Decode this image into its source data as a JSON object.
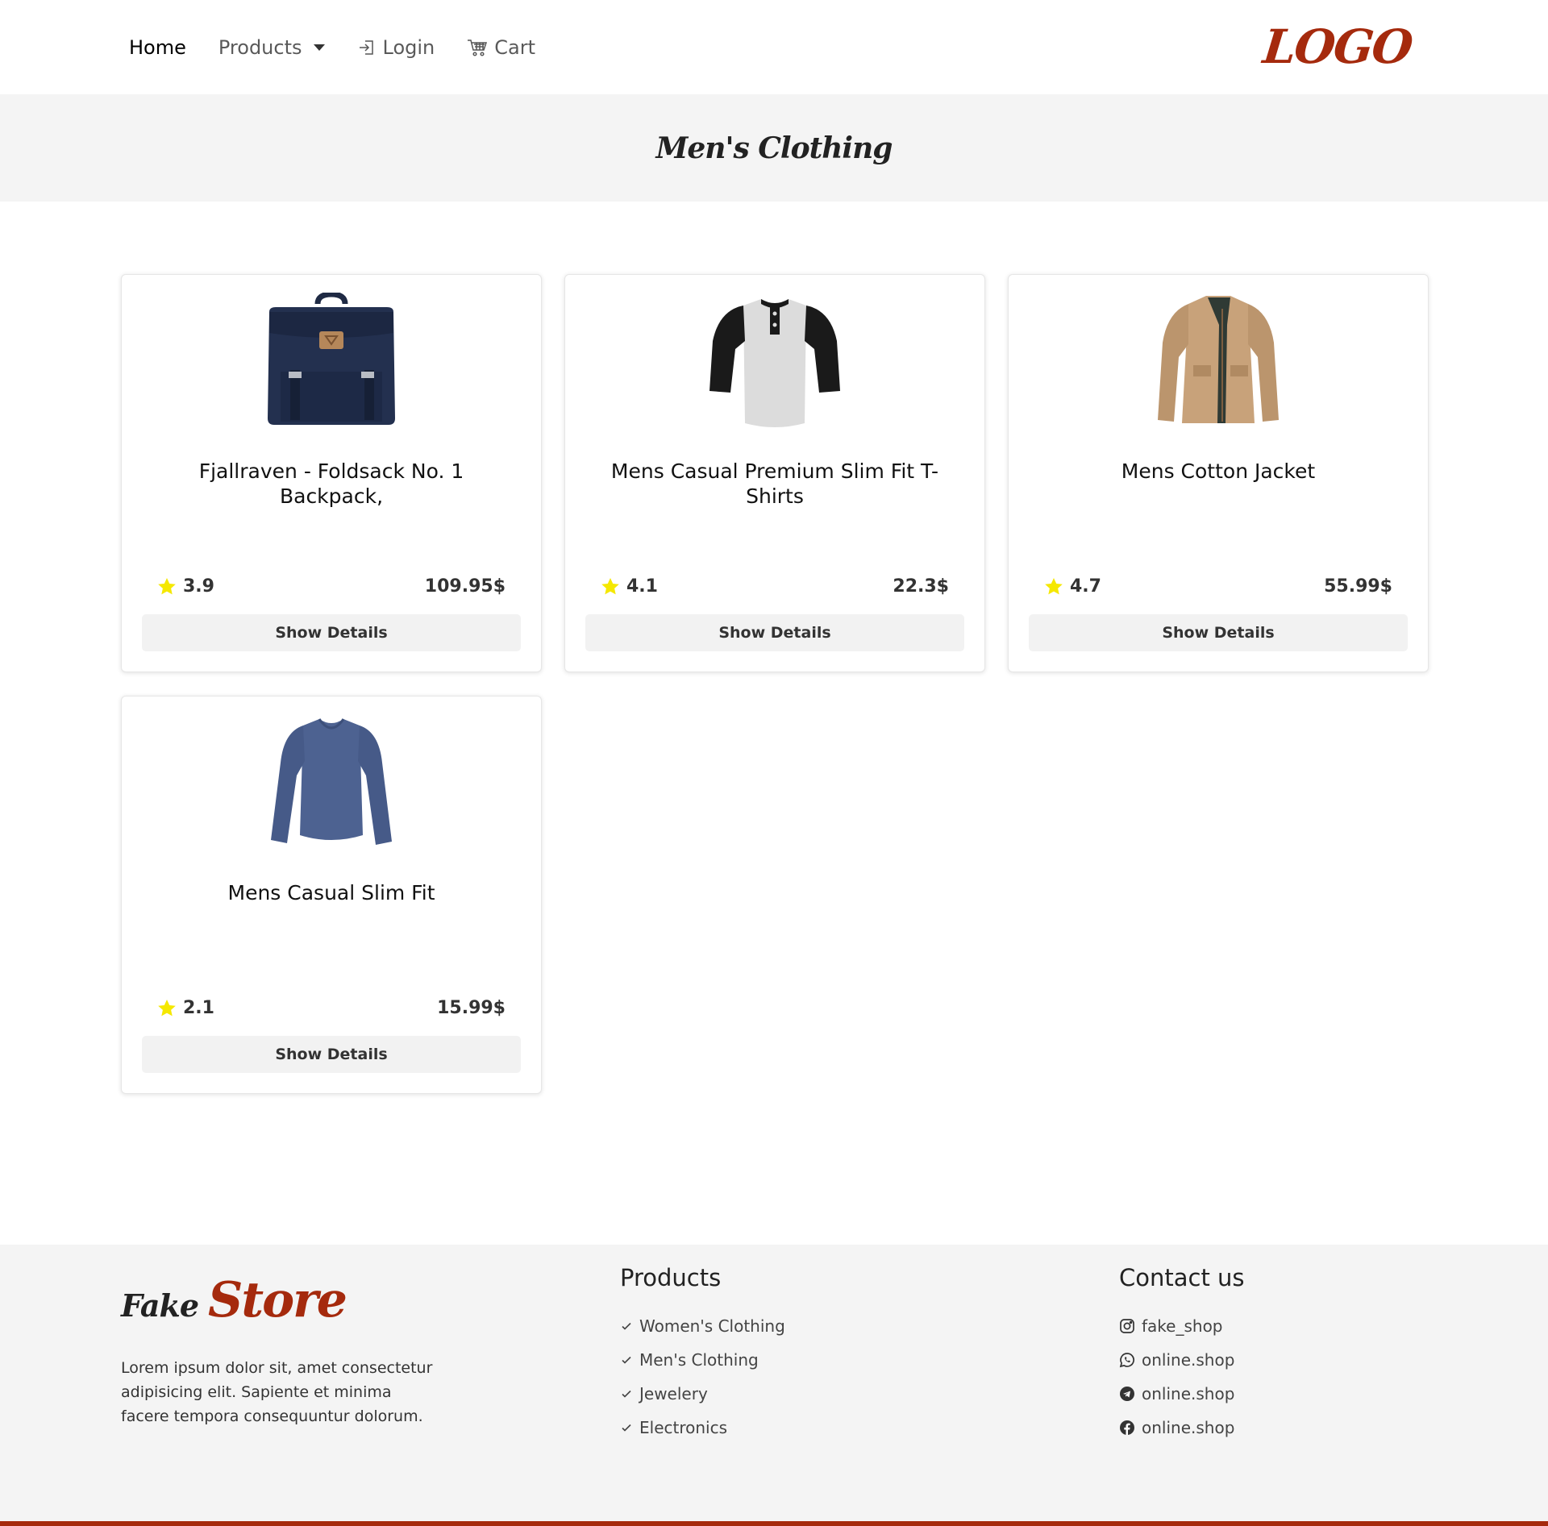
{
  "nav": {
    "home": "Home",
    "products": "Products",
    "login": "Login",
    "cart": "Cart",
    "logo": "LOGO"
  },
  "page_title": "Men's Clothing",
  "products": [
    {
      "title": "Fjallraven - Foldsack No. 1 Backpack,",
      "rating": "3.9",
      "price": "109.95$",
      "button": "Show Details",
      "image": "backpack-image"
    },
    {
      "title": "Mens Casual Premium Slim Fit T-Shirts",
      "rating": "4.1",
      "price": "22.3$",
      "button": "Show Details",
      "image": "tshirt-image"
    },
    {
      "title": "Mens Cotton Jacket",
      "rating": "4.7",
      "price": "55.99$",
      "button": "Show Details",
      "image": "jacket-image"
    },
    {
      "title": "Mens Casual Slim Fit",
      "rating": "2.1",
      "price": "15.99$",
      "button": "Show Details",
      "image": "longsleeve-image"
    }
  ],
  "footer": {
    "brand_1": "Fake",
    "brand_2": "Store",
    "description": "Lorem ipsum dolor sit, amet consectetur adipisicing elit. Sapiente et minima facere tempora consequuntur dolorum.",
    "products_heading": "Products",
    "product_links": [
      "Women's Clothing",
      "Men's Clothing",
      "Jewelery",
      "Electronics"
    ],
    "contact_heading": "Contact us",
    "contacts": [
      {
        "icon": "instagram-icon",
        "label": "fake_shop"
      },
      {
        "icon": "whatsapp-icon",
        "label": "online.shop"
      },
      {
        "icon": "telegram-icon",
        "label": "online.shop"
      },
      {
        "icon": "facebook-icon",
        "label": "online.shop"
      }
    ]
  },
  "colors": {
    "accent": "#a52a0d",
    "star": "#f5e800",
    "hero_bg": "#f4f4f4"
  }
}
